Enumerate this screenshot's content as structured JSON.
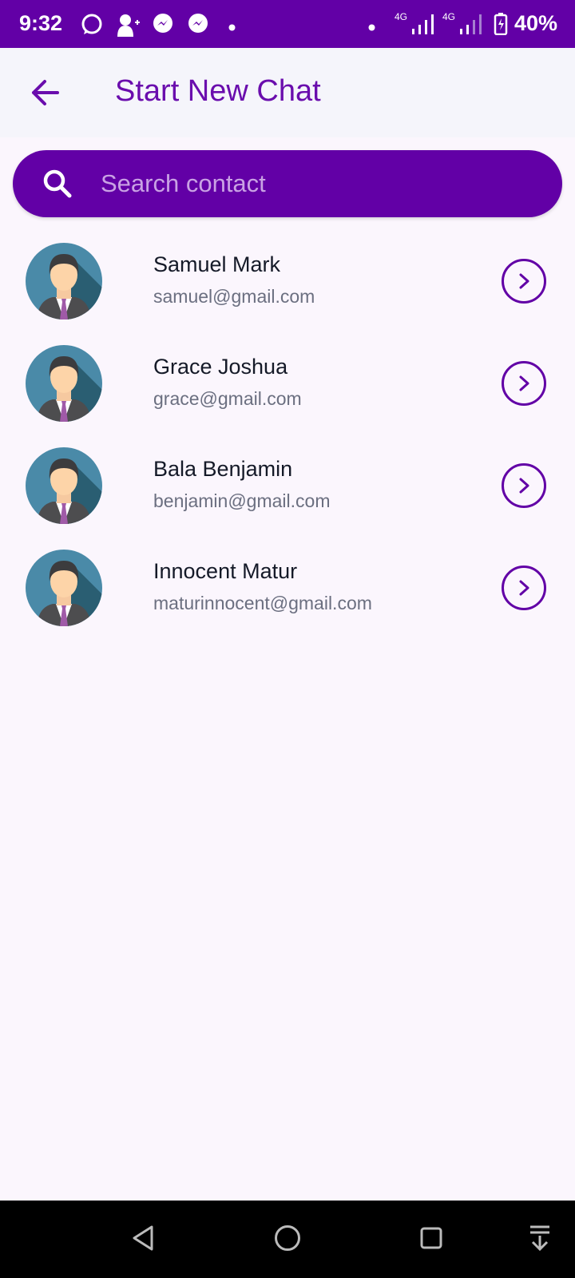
{
  "status_bar": {
    "time": "9:32",
    "battery": "40%",
    "network": "4G"
  },
  "header": {
    "title": "Start New Chat"
  },
  "search": {
    "placeholder": "Search contact",
    "value": ""
  },
  "contacts": [
    {
      "name": "Samuel Mark",
      "email": "samuel@gmail.com"
    },
    {
      "name": "Grace Joshua",
      "email": "grace@gmail.com"
    },
    {
      "name": "Bala Benjamin",
      "email": "benjamin@gmail.com"
    },
    {
      "name": "Innocent Matur",
      "email": "maturinnocent@gmail.com"
    }
  ],
  "colors": {
    "primary": "#6200a6",
    "title": "#6a0dad"
  }
}
